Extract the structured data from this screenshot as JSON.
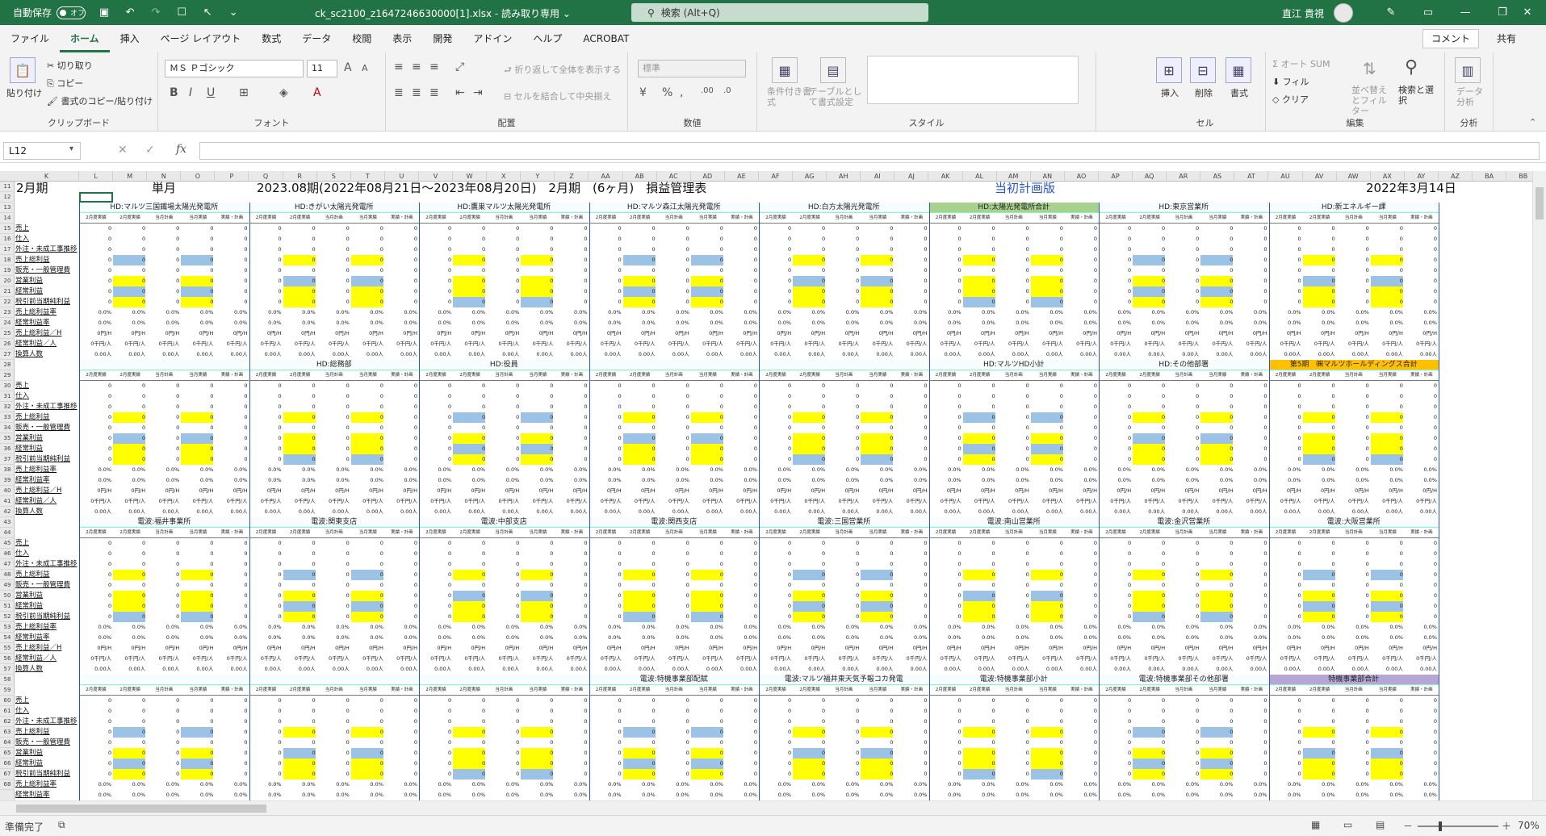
{
  "titlebar": {
    "autosave_label": "自動保存",
    "autosave_state": "オフ",
    "filename": "ck_sc2100_z1647246630000[1].xlsx  -  読み取り専用  ⌄",
    "search_placeholder": "検索 (Alt+Q)",
    "user_name": "直江 貴視"
  },
  "menu": {
    "items": [
      "ファイル",
      "ホーム",
      "挿入",
      "ページ レイアウト",
      "数式",
      "データ",
      "校閲",
      "表示",
      "開発",
      "アドイン",
      "ヘルプ",
      "ACROBAT"
    ],
    "active": "ホーム",
    "comment_label": "コメント",
    "share_label": "共有"
  },
  "ribbon": {
    "clipboard": {
      "label": "クリップボード",
      "paste": "貼り付け",
      "cut": "切り取り",
      "copy": "コピー",
      "format_painter": "書式のコピー/貼り付け"
    },
    "font": {
      "label": "フォント",
      "name": "ＭＳ Ｐゴシック",
      "size": "11"
    },
    "alignment": {
      "label": "配置",
      "wrap": "折り返して全体を表示する",
      "merge": "セルを結合して中央揃え"
    },
    "number": {
      "label": "数値",
      "format": "標準"
    },
    "styles": {
      "label": "スタイル",
      "conditional": "条件付き書式",
      "table": "テーブルとして書式設定"
    },
    "cells": {
      "label": "セル",
      "insert": "挿入",
      "delete": "削除",
      "format": "書式"
    },
    "editing": {
      "label": "編集",
      "autosum": "オート SUM",
      "fill": "フィル",
      "clear": "クリア",
      "sort": "並べ替えとフィルター",
      "find": "検索と選択"
    },
    "analysis": {
      "label": "分析",
      "data_analysis": "データ分析"
    }
  },
  "formula": {
    "name_box": "L12",
    "value": ""
  },
  "sheet": {
    "columns": [
      "K",
      "L",
      "M",
      "N",
      "O",
      "P",
      "Q",
      "R",
      "S",
      "T",
      "U",
      "V",
      "W",
      "X",
      "Y",
      "Z",
      "AA",
      "AB",
      "AC",
      "AD",
      "AE",
      "AF",
      "AG",
      "AH",
      "AI",
      "AJ",
      "AK",
      "AL",
      "AM",
      "AN",
      "AO",
      "AP",
      "AQ",
      "AR",
      "AS",
      "AT",
      "AU",
      "AV",
      "AW",
      "AX",
      "AY",
      "AZ",
      "BA",
      "BB"
    ],
    "rows": [
      "11",
      "12",
      "13",
      "14",
      "15",
      "16",
      "17",
      "18",
      "19",
      "20",
      "21",
      "22",
      "23",
      "24",
      "25",
      "26",
      "27",
      "28",
      "29",
      "30",
      "31",
      "32",
      "33",
      "34",
      "35",
      "36",
      "37",
      "38",
      "39",
      "40",
      "41",
      "42",
      "43",
      "44",
      "45",
      "46",
      "47",
      "48",
      "49",
      "50",
      "51",
      "52",
      "53",
      "54",
      "55",
      "56",
      "57",
      "58",
      "59",
      "60",
      "61",
      "62",
      "63",
      "64",
      "65",
      "66",
      "67",
      "68"
    ],
    "title_left": "2月期",
    "title_mode": "単月",
    "title_period": "2023.08期(2022年08月21日～2023年08月20日)　2月期　(6ヶ月)　損益管理表",
    "title_plan": "当初計画版",
    "title_date": "2022年3月14日",
    "block_rows": [
      [
        "HD:マルツ三国鐵場太陽光発電所",
        "HD:きがい太陽光発電所",
        "HD:鷹巣マルツ太陽光発電所",
        "HD:マルツ森江太陽光発電所",
        "HD:白方太陽光発電所",
        "HD:太陽光発電所合計",
        "HD:東京営業所",
        "HD:新エネルギー課"
      ],
      [
        "",
        "HD:総務部",
        "HD:役員",
        "",
        "",
        "HD:マルツHD小計",
        "HD:その他部署",
        "第5期　㈱マルツホールディングス合計"
      ],
      [
        "電波:福井事業所",
        "電波:関東支店",
        "電波:中部支店",
        "電波:関西支店",
        "電波:三国営業所",
        "電波:南山営業所",
        "電波:金沢営業所",
        "電波:大阪営業所"
      ],
      [
        "",
        "",
        "",
        "電波:特機事業部配賦",
        "電波:マルツ福井東天気予報コカ発電",
        "電波:特機事業部小計",
        "電波:特機事業部その他部署",
        "特機事業部合計"
      ]
    ],
    "subheaders": [
      "2月度実績",
      "2月度実績",
      "当月計画",
      "当月実績",
      "実績・計画"
    ],
    "row_labels": [
      "売上",
      "仕入",
      "外注・未成工事推移",
      "売上総利益",
      "販売・一般管理費",
      "営業利益",
      "経常利益",
      "税引前当期純利益",
      "売上総利益率",
      "経常利益率",
      "売上総利益／H",
      "経常利益／人",
      "換算人数"
    ],
    "zero": "0",
    "pct": "0.0%",
    "perh": "0円/H",
    "perman": "0千円/人",
    "people": "0.00人"
  },
  "status": {
    "ready": "準備完了",
    "zoom": "70%"
  }
}
